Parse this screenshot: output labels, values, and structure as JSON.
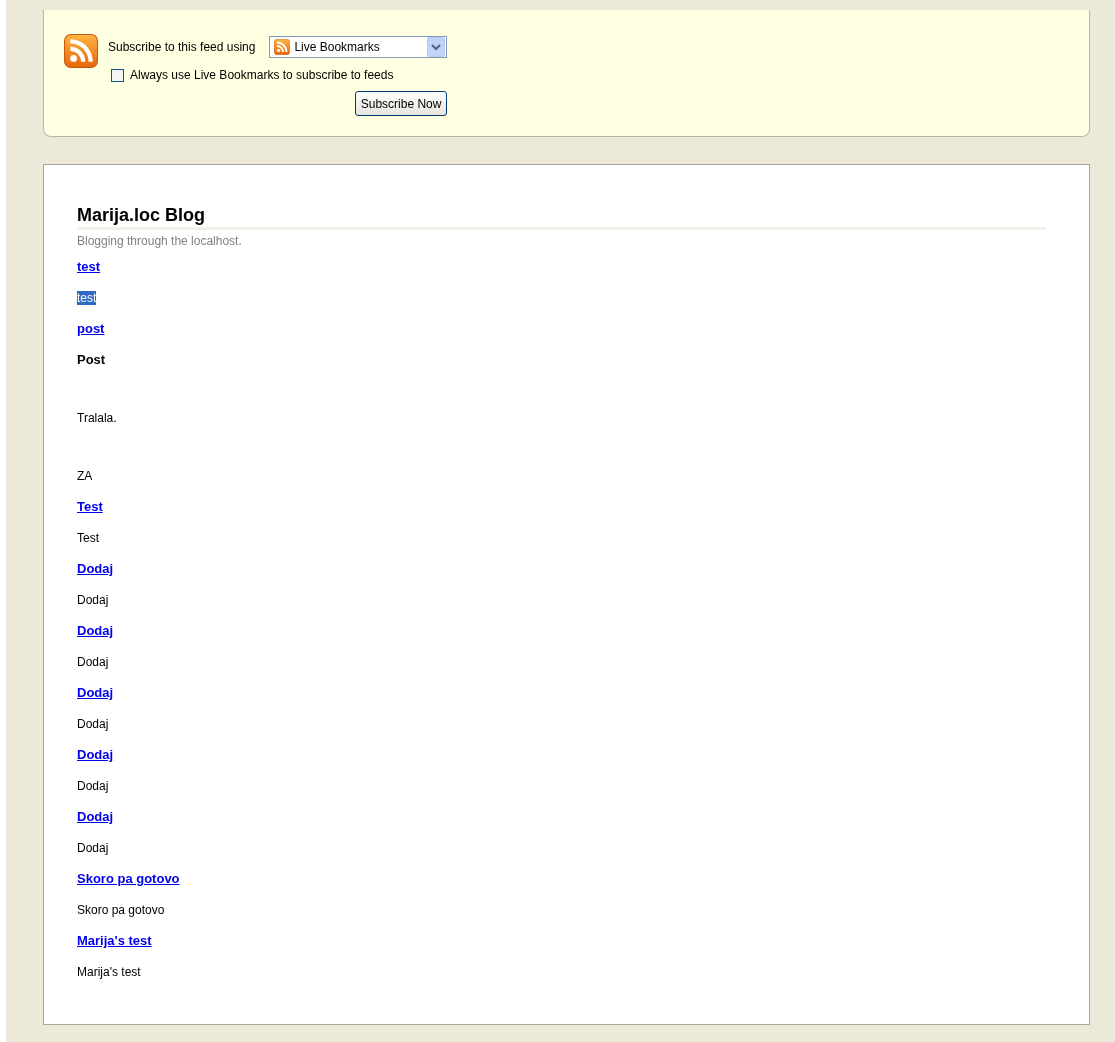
{
  "subscribe": {
    "label": "Subscribe to this feed using",
    "reader": "Live Bookmarks",
    "always_use": {
      "label": "Always use Live Bookmarks to subscribe to feeds",
      "checked": false
    },
    "button": "Subscribe Now"
  },
  "blog": {
    "title": "Marija.loc Blog",
    "tagline": "Blogging through the localhost.",
    "entries": [
      {
        "title": "test",
        "paragraphs": [
          {
            "kind": "text",
            "text": "test",
            "highlighted": true
          }
        ]
      },
      {
        "title": "post",
        "paragraphs": [
          {
            "kind": "heading",
            "text": "Post",
            "highlighted": false
          },
          {
            "kind": "paragraph",
            "text": "Tralala.",
            "highlighted": false
          },
          {
            "kind": "paragraph",
            "text": "ZA",
            "highlighted": false
          }
        ]
      },
      {
        "title": "Test",
        "paragraphs": [
          {
            "kind": "text",
            "text": "Test",
            "highlighted": false
          }
        ]
      },
      {
        "title": "Dodaj",
        "paragraphs": [
          {
            "kind": "text",
            "text": "Dodaj",
            "highlighted": false
          }
        ]
      },
      {
        "title": "Dodaj",
        "paragraphs": [
          {
            "kind": "text",
            "text": "Dodaj",
            "highlighted": false
          }
        ]
      },
      {
        "title": "Dodaj",
        "paragraphs": [
          {
            "kind": "text",
            "text": "Dodaj",
            "highlighted": false
          }
        ]
      },
      {
        "title": "Dodaj",
        "paragraphs": [
          {
            "kind": "text",
            "text": "Dodaj",
            "highlighted": false
          }
        ]
      },
      {
        "title": "Dodaj",
        "paragraphs": [
          {
            "kind": "text",
            "text": "Dodaj",
            "highlighted": false
          }
        ]
      },
      {
        "title": "Skoro pa gotovo",
        "paragraphs": [
          {
            "kind": "text",
            "text": "Skoro pa gotovo",
            "highlighted": false
          }
        ]
      },
      {
        "title": "Marija's test",
        "paragraphs": [
          {
            "kind": "text",
            "text": "Marija's test",
            "highlighted": false
          }
        ]
      }
    ]
  }
}
